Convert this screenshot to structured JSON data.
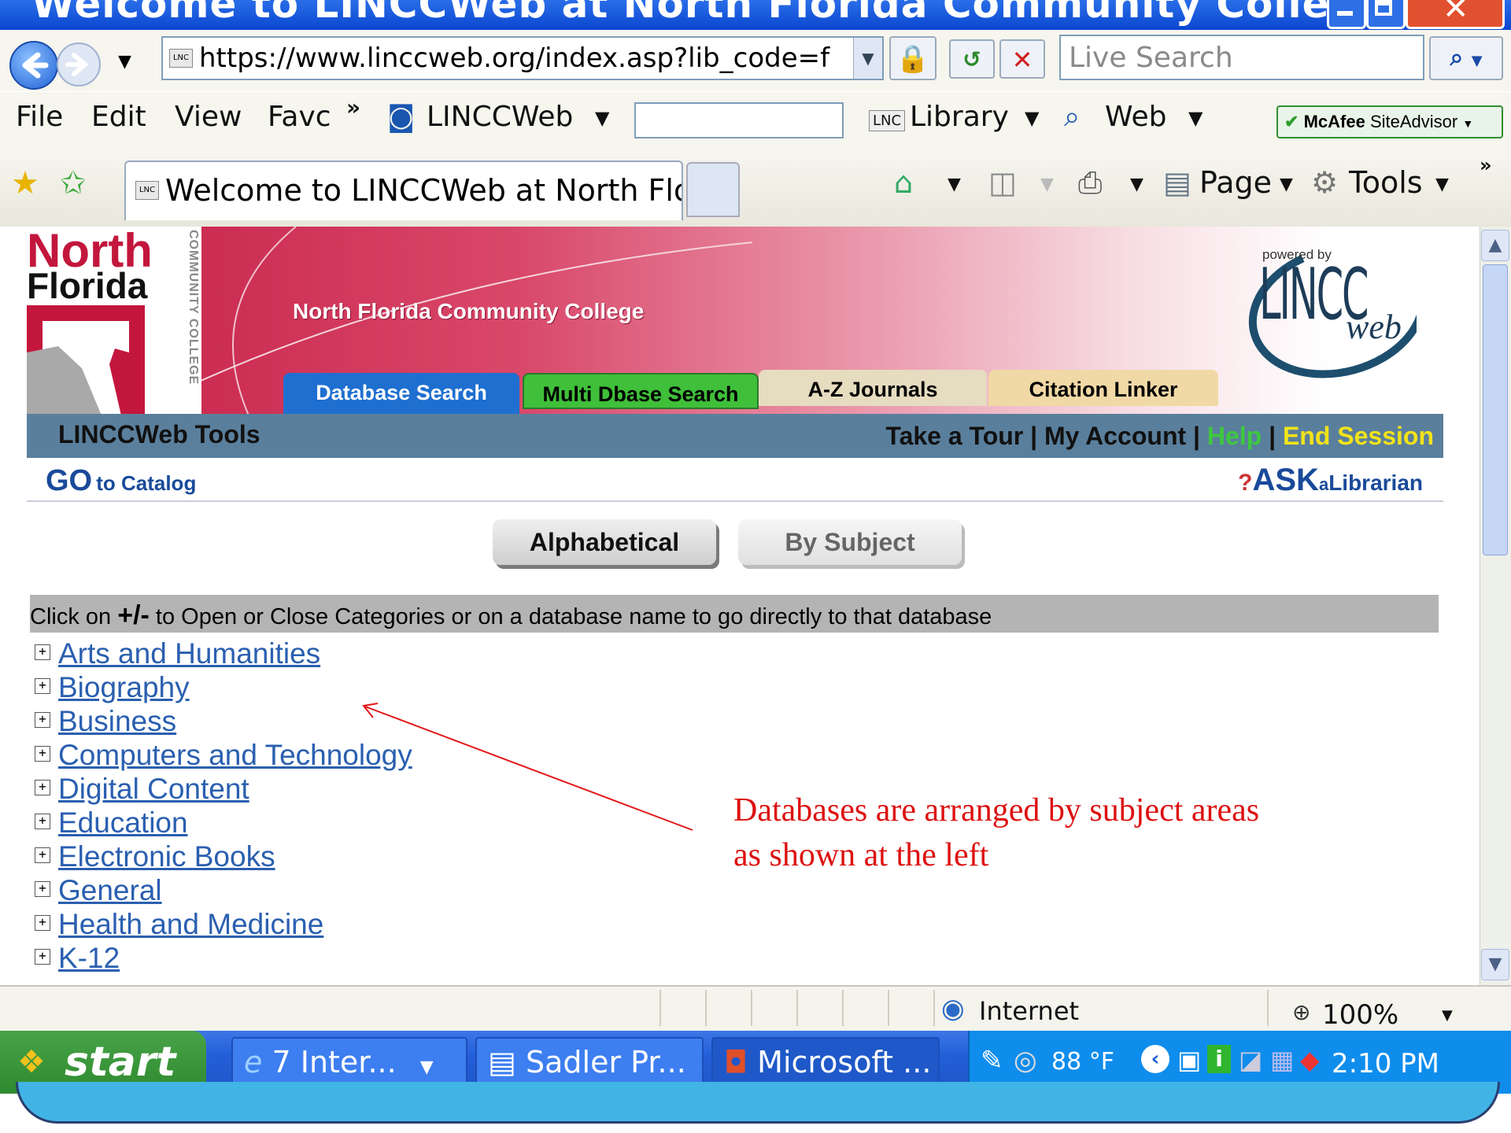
{
  "window": {
    "title": "Welcome to LINCCWeb at North Florida Community College -..."
  },
  "nav": {
    "url": "https://www.linccweb.org/index.asp?lib_code=f",
    "search_placeholder": "Live Search"
  },
  "menu": {
    "items": [
      "File",
      "Edit",
      "View",
      "Favc"
    ],
    "linccweb": "LINCCWeb",
    "library": "Library",
    "web": "Web",
    "mcafee": "McAfee",
    "siteadvisor": "SiteAdvisor"
  },
  "favbar": {
    "tab_title": "Welcome to LINCCWeb at North Flo...",
    "page": "Page",
    "tools": "Tools"
  },
  "site": {
    "logo_north": "North",
    "logo_florida": "Florida",
    "logo_cc": "COMMUNITY COLLEGE",
    "college_name": "North Florida Community College",
    "powered_by": "powered by",
    "lincc": "LINCC",
    "web": "web",
    "tabs": [
      {
        "label": "Database Search",
        "color": "#1e6fd0"
      },
      {
        "label": "Multi Dbase Search",
        "color": "#3fbf3a"
      },
      {
        "label": "A-Z Journals",
        "color": "#e6dcc0"
      },
      {
        "label": "Citation Linker",
        "color": "#f0d9a6"
      }
    ],
    "tools_label": "LINCCWeb Tools",
    "links": {
      "tour": "Take a Tour",
      "account": "My Account",
      "help": "Help",
      "end": "End Session",
      "sep": "|"
    },
    "go_catalog_go": "GO",
    "go_catalog_to": "to Catalog",
    "ask_ask": "ASK",
    "ask_a": "a",
    "ask_lib": "Librarian",
    "alphabetical": "Alphabetical",
    "by_subject": "By Subject",
    "instr_pre": "Click on",
    "instr_sym": "+/-",
    "instr_post": "to Open or Close Categories or on a database name to go directly to that database",
    "categories": [
      "Arts and Humanities",
      "Biography",
      "Business",
      "Computers and Technology",
      "Digital Content",
      "Education",
      "Electronic Books",
      "General",
      "Health and Medicine",
      "K-12"
    ]
  },
  "annotation": {
    "line1": "Databases are arranged by subject areas",
    "line2": "as shown at the left"
  },
  "status": {
    "zone": "Internet",
    "zoom": "100%"
  },
  "taskbar": {
    "start": "start",
    "tasks": [
      "7 Inter...",
      "Sadler Pr...",
      "Microsoft ..."
    ],
    "temp": "88 °F",
    "time": "2:10 PM"
  }
}
